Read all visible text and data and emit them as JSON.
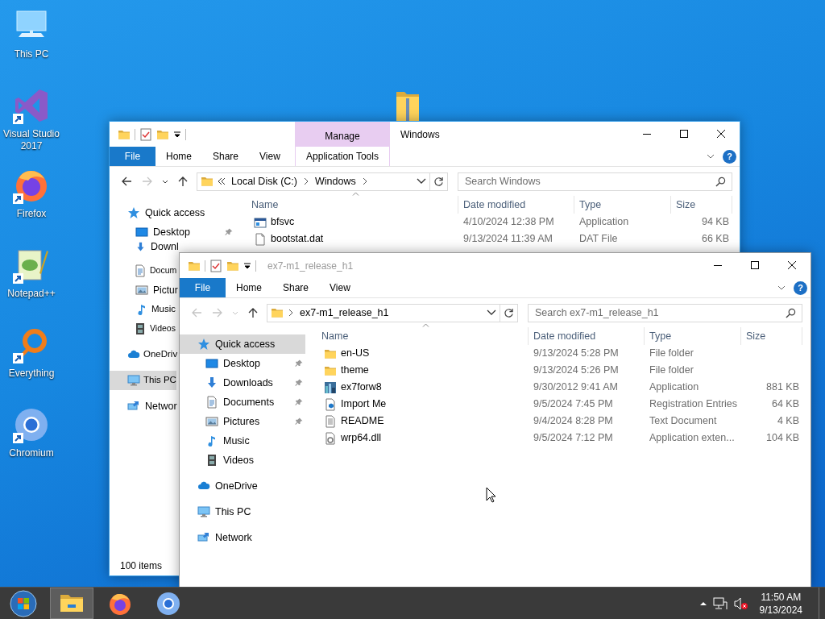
{
  "desktop_icons": [
    {
      "label": "This PC",
      "kind": "pc",
      "shortcut": false
    },
    {
      "label": "Visual Studio 2017",
      "kind": "vs",
      "shortcut": true
    },
    {
      "label": "Firefox",
      "kind": "firefox",
      "shortcut": true
    },
    {
      "label": "Notepad++",
      "kind": "notepad",
      "shortcut": true
    },
    {
      "label": "Everything",
      "kind": "everything",
      "shortcut": true
    },
    {
      "label": "Chromium",
      "kind": "chromium",
      "shortcut": true
    }
  ],
  "windows": [
    {
      "title": "Windows",
      "active": true,
      "context_tab": {
        "group": "Manage",
        "label": "Application Tools"
      },
      "ribbon_tabs": [
        "File",
        "Home",
        "Share",
        "View"
      ],
      "help": "?",
      "back_enabled": true,
      "forward_enabled": false,
      "address": {
        "overflow": true,
        "crumbs": [
          "Local Disk (C:)",
          "Windows"
        ],
        "trailing_chevron": true
      },
      "search": {
        "placeholder": "Search Windows"
      },
      "nav": [
        {
          "label": "Quick access",
          "kind": "star",
          "selected": false,
          "children": [
            {
              "label": "Desktop",
              "kind": "desktop",
              "pinned": true,
              "selected": false
            },
            {
              "label": "Downl",
              "kind": "download",
              "pinned": false,
              "selected": false
            },
            {
              "label": "Docum",
              "kind": "document",
              "pinned": false,
              "selected": false
            },
            {
              "label": "Pictur",
              "kind": "picture",
              "pinned": false,
              "selected": false
            },
            {
              "label": "Music",
              "kind": "music",
              "pinned": false,
              "selected": false
            },
            {
              "label": "Videos",
              "kind": "video",
              "pinned": false,
              "selected": false
            }
          ]
        },
        {
          "label": "OneDriv",
          "kind": "cloud",
          "selected": false
        },
        {
          "label": "This PC",
          "kind": "pc",
          "selected": true
        },
        {
          "label": "Networ",
          "kind": "network",
          "selected": false
        }
      ],
      "columns": [
        "Name",
        "Date modified",
        "Type",
        "Size"
      ],
      "files": [
        {
          "name": "bfsvc",
          "date": "4/10/2024 12:38 PM",
          "type": "Application",
          "size": "94 KB",
          "kind": "app"
        },
        {
          "name": "bootstat.dat",
          "date": "9/13/2024 11:39 AM",
          "type": "DAT File",
          "size": "66 KB",
          "kind": "file"
        }
      ],
      "status_bar": "100 items"
    },
    {
      "title": "ex7-m1_release_h1",
      "active": false,
      "ribbon_tabs": [
        "File",
        "Home",
        "Share",
        "View"
      ],
      "help": "?",
      "back_enabled": false,
      "forward_enabled": false,
      "address": {
        "overflow": false,
        "crumbs": [
          "ex7-m1_release_h1"
        ],
        "trailing_chevron": false
      },
      "search": {
        "placeholder": "Search ex7-m1_release_h1"
      },
      "nav": [
        {
          "label": "Quick access",
          "kind": "star",
          "selected": true,
          "children": [
            {
              "label": "Desktop",
              "kind": "desktop",
              "pinned": true,
              "selected": false
            },
            {
              "label": "Downloads",
              "kind": "download",
              "pinned": true,
              "selected": false
            },
            {
              "label": "Documents",
              "kind": "document",
              "pinned": true,
              "selected": false
            },
            {
              "label": "Pictures",
              "kind": "picture",
              "pinned": true,
              "selected": false
            },
            {
              "label": "Music",
              "kind": "music",
              "pinned": false,
              "selected": false
            },
            {
              "label": "Videos",
              "kind": "video",
              "pinned": false,
              "selected": false
            }
          ]
        },
        {
          "label": "OneDrive",
          "kind": "cloud",
          "selected": false
        },
        {
          "label": "This PC",
          "kind": "pc",
          "selected": false
        },
        {
          "label": "Network",
          "kind": "network",
          "selected": false
        }
      ],
      "columns": [
        "Name",
        "Date modified",
        "Type",
        "Size"
      ],
      "files": [
        {
          "name": "en-US",
          "date": "9/13/2024 5:28 PM",
          "type": "File folder",
          "kind": "folder"
        },
        {
          "name": "theme",
          "date": "9/13/2024 5:26 PM",
          "type": "File folder",
          "kind": "folder"
        },
        {
          "name": "ex7forw8",
          "date": "9/30/2012 9:41 AM",
          "type": "Application",
          "size": "881 KB",
          "kind": "exe"
        },
        {
          "name": "Import Me",
          "date": "9/5/2024 7:45 PM",
          "type": "Registration Entries",
          "size": "64 KB",
          "kind": "reg"
        },
        {
          "name": "README",
          "date": "9/4/2024 8:28 PM",
          "type": "Text Document",
          "size": "4 KB",
          "kind": "text"
        },
        {
          "name": "wrp64.dll",
          "date": "9/5/2024 7:12 PM",
          "type": "Application exten...",
          "size": "104 KB",
          "kind": "dll"
        }
      ]
    }
  ],
  "taskbar": {
    "apps": [
      {
        "kind": "explorer",
        "selected": true
      },
      {
        "kind": "firefox",
        "selected": false
      },
      {
        "kind": "chromium",
        "selected": false
      }
    ],
    "volume_muted": true,
    "time": "11:50 AM",
    "date": "9/13/2024"
  }
}
